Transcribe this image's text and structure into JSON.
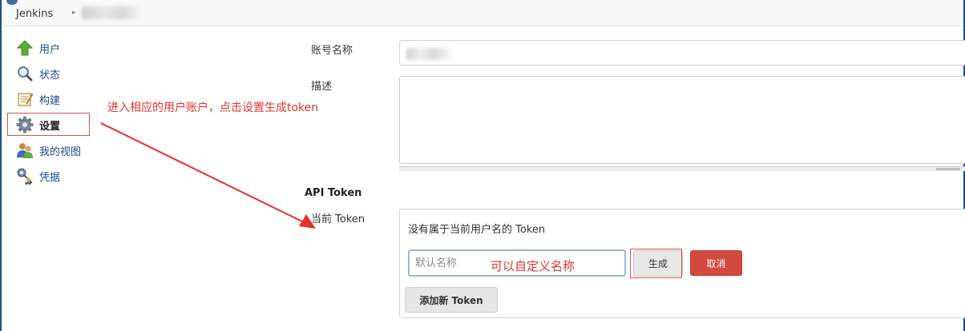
{
  "breadcrumb": {
    "root": "Jenkins",
    "separator": "▸"
  },
  "sidebar": {
    "items": [
      {
        "label": "用户",
        "icon": "up-arrow-icon"
      },
      {
        "label": "状态",
        "icon": "magnifier-icon"
      },
      {
        "label": "构建",
        "icon": "notepad-icon"
      },
      {
        "label": "设置",
        "icon": "gear-icon",
        "active": true
      },
      {
        "label": "我的视图",
        "icon": "user-group-icon"
      },
      {
        "label": "凭据",
        "icon": "key-icon"
      }
    ]
  },
  "annotations": {
    "sidebar_note": "进入相应的用户账户，点击设置生成token",
    "name_note": "可以自定义名称",
    "color": "#e0352f"
  },
  "form": {
    "username_label": "账号名称",
    "description_label": "描述"
  },
  "api_token": {
    "section_title": "API Token",
    "current_label": "当前 Token",
    "empty_message": "没有属于当前用户名的 Token",
    "name_placeholder": "默认名称",
    "generate_label": "生成",
    "cancel_label": "取消",
    "add_label": "添加新 Token"
  },
  "colors": {
    "link": "#204a87",
    "danger": "#d24a3e",
    "highlight": "#d9534f"
  }
}
